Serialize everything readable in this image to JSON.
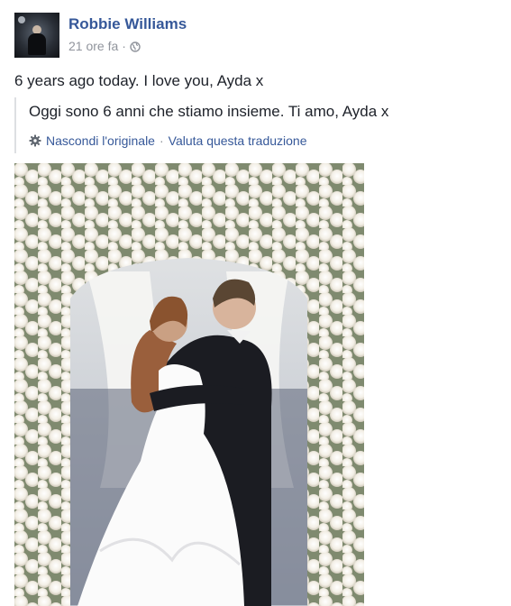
{
  "post": {
    "author": "Robbie Williams",
    "time": "21 ore fa",
    "separator": "·",
    "privacy_icon": "globe-icon",
    "text": "6 years ago today. I love you, Ayda x",
    "translation": {
      "text": "Oggi sono 6 anni che stiamo insieme. Ti amo, Ayda x",
      "settings_icon": "gear-icon",
      "hide_original_label": "Nascondi l'originale",
      "separator": "·",
      "rate_label": "Valuta questa traduzione"
    },
    "photo_description": "wedding-photo"
  },
  "colors": {
    "link": "#365899",
    "meta": "#90949c",
    "text": "#1d2129"
  }
}
